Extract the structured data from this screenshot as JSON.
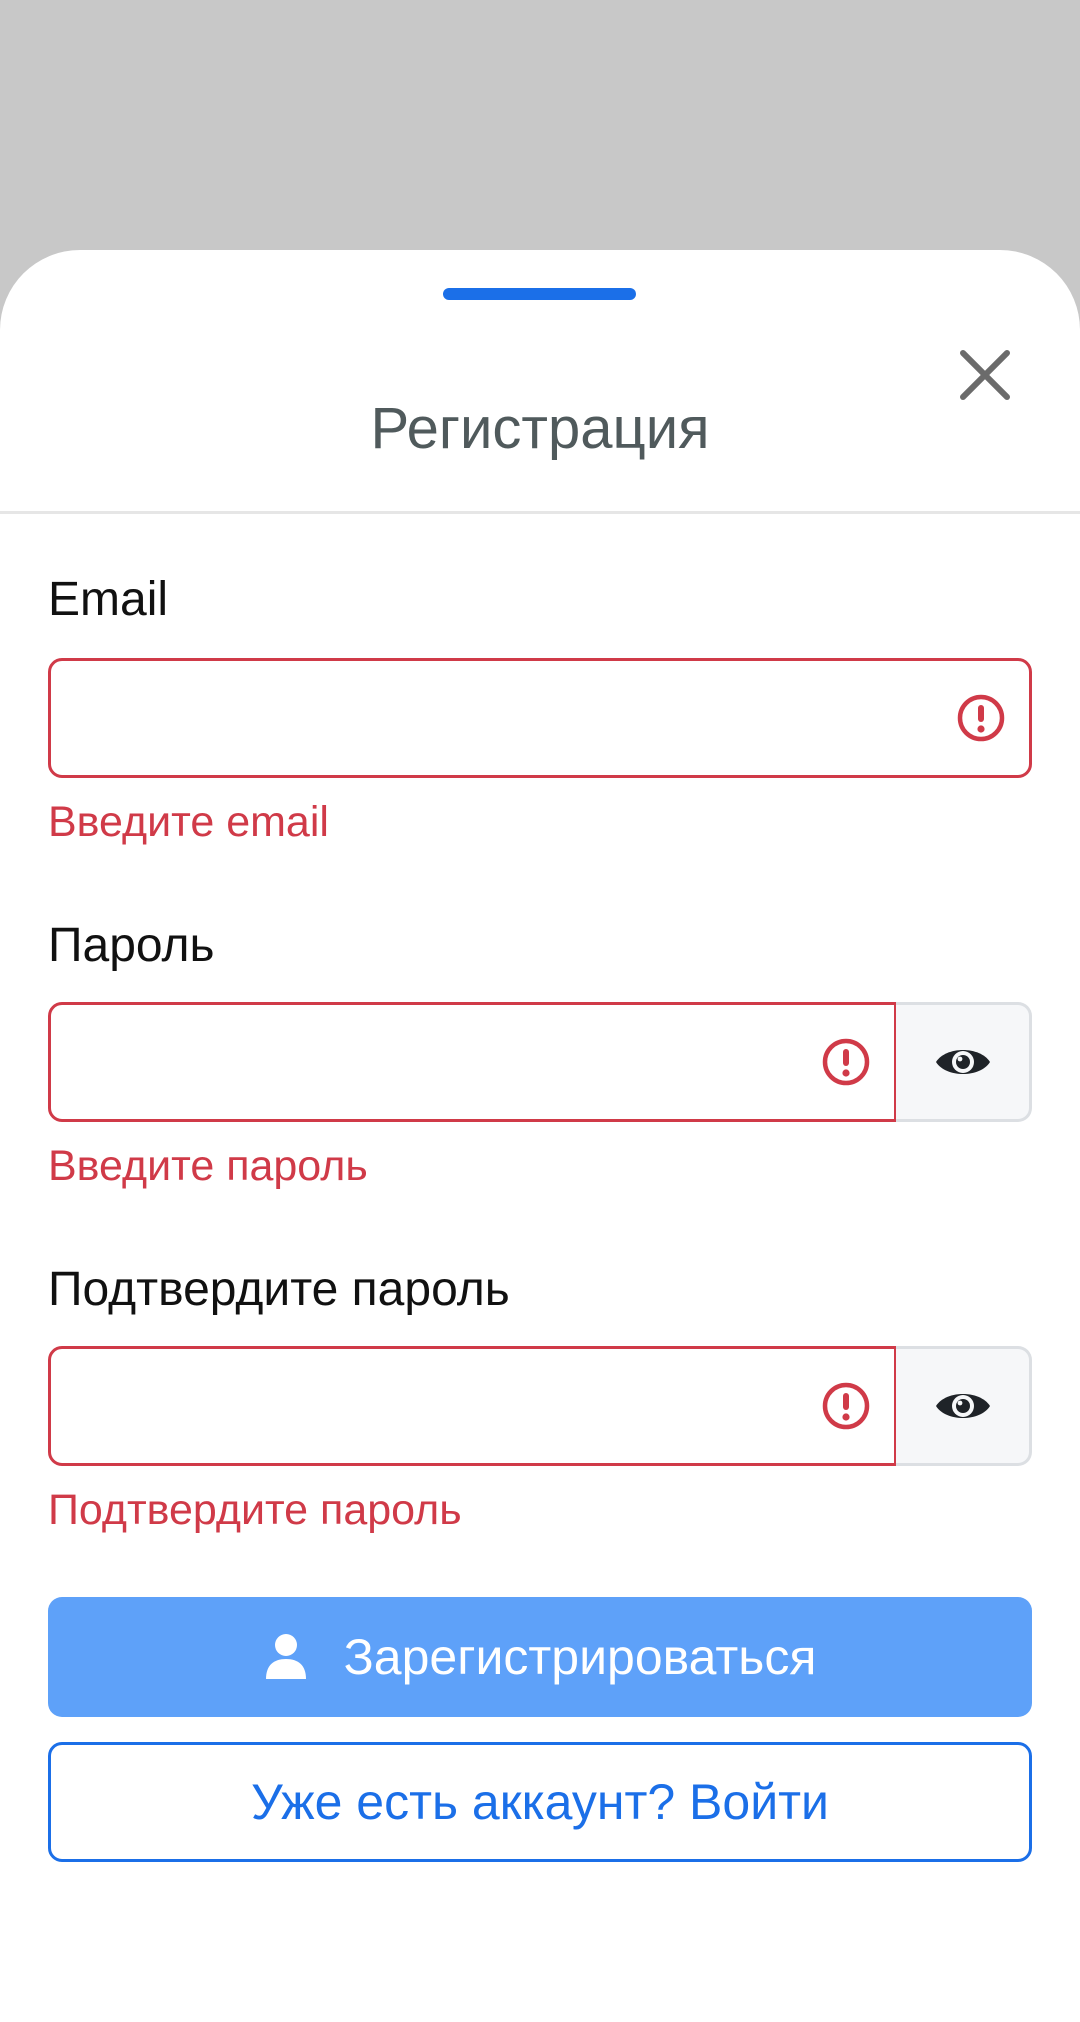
{
  "header": {
    "title": "Регистрация"
  },
  "fields": {
    "email": {
      "label": "Email",
      "value": "",
      "error": "Введите email"
    },
    "password": {
      "label": "Пароль",
      "value": "",
      "error": "Введите пароль"
    },
    "confirm": {
      "label": "Подтвердите пароль",
      "value": "",
      "error": "Подтвердите пароль"
    }
  },
  "actions": {
    "register_label": "Зарегистрироваться",
    "login_label": "Уже есть аккаунт? Войти"
  },
  "icons": {
    "close": "close-icon",
    "alert": "alert-circle-icon",
    "eye": "eye-icon",
    "user": "user-icon"
  },
  "colors": {
    "accent": "#1b6fe8",
    "accent_light": "#5ea1f9",
    "error": "#d03a48",
    "backdrop": "#c8c8c8"
  }
}
